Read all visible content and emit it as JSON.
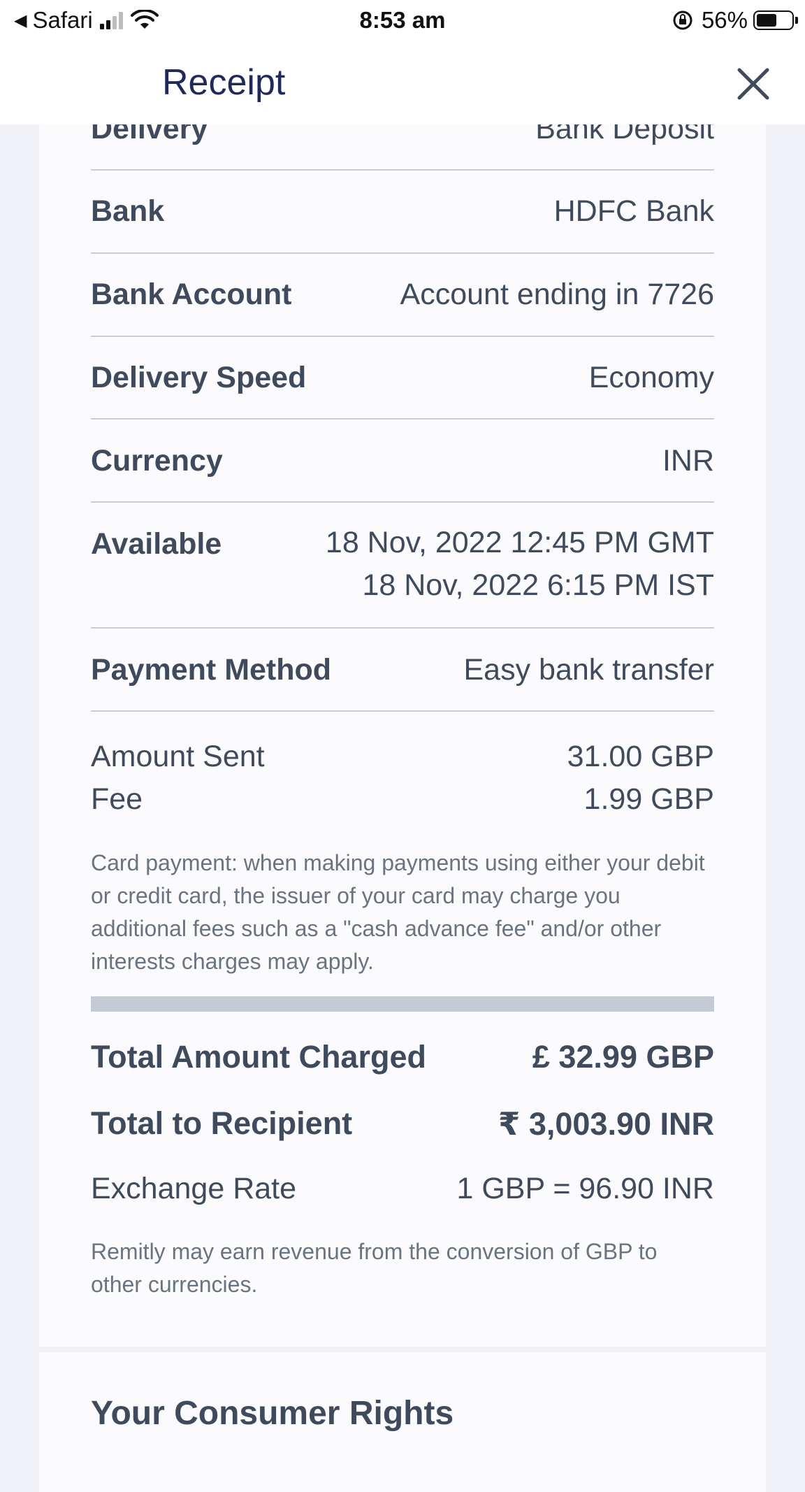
{
  "status_bar": {
    "back_app": "Safari",
    "time": "8:53 am",
    "battery": "56%"
  },
  "header": {
    "title": "Receipt"
  },
  "receipt": {
    "delivery": {
      "label": "Delivery",
      "value": "Bank Deposit"
    },
    "bank": {
      "label": "Bank",
      "value": "HDFC Bank"
    },
    "bank_account": {
      "label": "Bank Account",
      "value": "Account ending in 7726"
    },
    "delivery_speed": {
      "label": "Delivery Speed",
      "value": "Economy"
    },
    "currency": {
      "label": "Currency",
      "value": "INR"
    },
    "available": {
      "label": "Available",
      "value_line1": "18 Nov, 2022 12:45 PM GMT",
      "value_line2": "18 Nov, 2022 6:15 PM IST"
    },
    "payment_method": {
      "label": "Payment Method",
      "value": "Easy bank transfer"
    },
    "amount_sent": {
      "label": "Amount Sent",
      "value": "31.00 GBP"
    },
    "fee": {
      "label": "Fee",
      "value": "1.99 GBP"
    },
    "card_note": "Card payment: when making payments using either your debit or credit card, the issuer of your card may charge you additional fees such as a \"cash advance fee\" and/or other interests charges may apply.",
    "total_charged": {
      "label": "Total Amount Charged",
      "value": "£ 32.99 GBP"
    },
    "total_recipient": {
      "label": "Total to Recipient",
      "value": "₹ 3,003.90 INR"
    },
    "exchange_rate": {
      "label": "Exchange Rate",
      "value": "1 GBP = 96.90 INR"
    },
    "revenue_note": "Remitly may earn revenue from the conversion of GBP to other currencies."
  },
  "consumer_rights": {
    "title": "Your Consumer Rights"
  }
}
